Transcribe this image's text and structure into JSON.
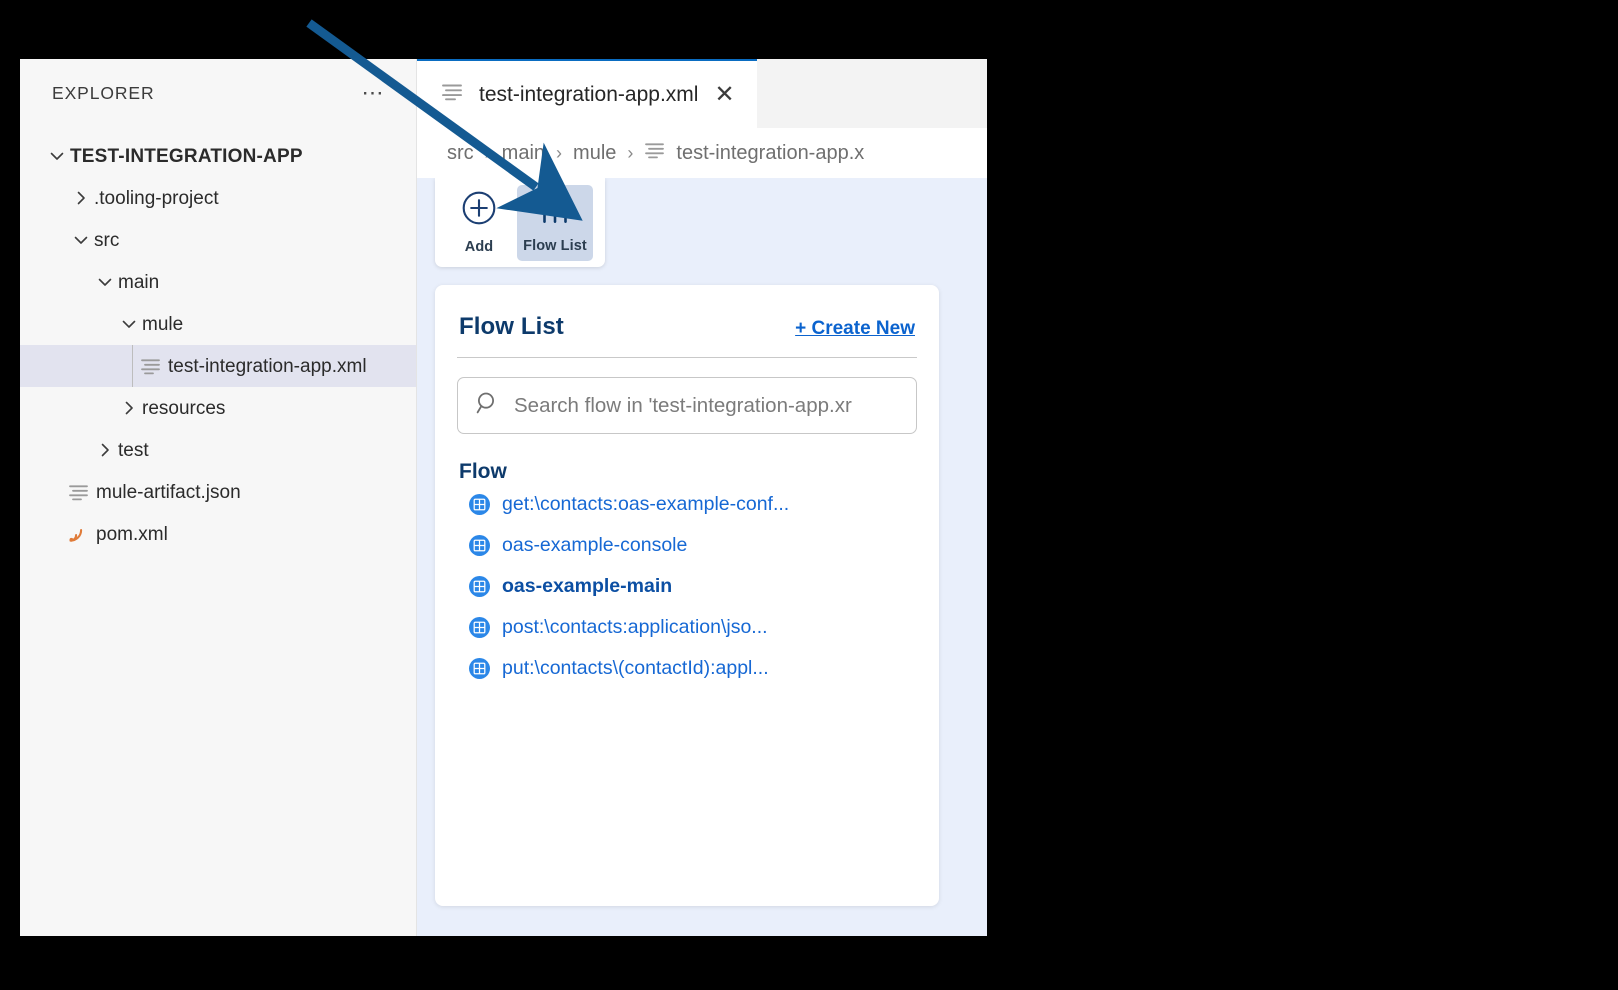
{
  "explorer": {
    "title": "EXPLORER",
    "more_icon": "ellipsis-icon",
    "tree": [
      {
        "label": "TEST-INTEGRATION-APP",
        "depth": 0,
        "type": "folder",
        "expanded": true,
        "bold": true
      },
      {
        "label": ".tooling-project",
        "depth": 1,
        "type": "folder",
        "expanded": false,
        "bold": false
      },
      {
        "label": "src",
        "depth": 1,
        "type": "folder",
        "expanded": true,
        "bold": false
      },
      {
        "label": "main",
        "depth": 2,
        "type": "folder",
        "expanded": true,
        "bold": false
      },
      {
        "label": "mule",
        "depth": 3,
        "type": "folder",
        "expanded": true,
        "bold": false
      },
      {
        "label": "test-integration-app.xml",
        "depth": 4,
        "type": "xml-file",
        "selected": true,
        "bold": false
      },
      {
        "label": "resources",
        "depth": 3,
        "type": "folder",
        "expanded": false,
        "bold": false
      },
      {
        "label": "test",
        "depth": 2,
        "type": "folder",
        "expanded": false,
        "bold": false
      },
      {
        "label": "mule-artifact.json",
        "depth": 1,
        "type": "json-file",
        "bold": false
      },
      {
        "label": "pom.xml",
        "depth": 1,
        "type": "pom-file",
        "bold": false
      }
    ]
  },
  "editor": {
    "tab": {
      "icon": "file-lines-icon",
      "title": "test-integration-app.xml",
      "close_label": "✕"
    },
    "breadcrumb": {
      "separator": "›",
      "items": [
        "src",
        "main",
        "mule"
      ],
      "file": "test-integration-app.x"
    },
    "toolbar": {
      "buttons": [
        {
          "label": "Add",
          "icon": "plus-circle-icon",
          "active": false
        },
        {
          "label": "Flow List",
          "icon": "sliders-icon",
          "active": true
        }
      ]
    },
    "flow_panel": {
      "title": "Flow List",
      "create_new_label": "+ Create New",
      "search": {
        "icon": "search-icon",
        "placeholder": "Search flow in  'test-integration-app.xr"
      },
      "group_label": "Flow",
      "items": [
        {
          "label": "get:\\contacts:oas-example-conf...",
          "icon": "flow-icon",
          "current": false
        },
        {
          "label": "oas-example-console",
          "icon": "flow-icon",
          "current": false
        },
        {
          "label": "oas-example-main",
          "icon": "flow-icon",
          "current": true
        },
        {
          "label": "post:\\contacts:application\\jso...",
          "icon": "flow-icon",
          "current": false
        },
        {
          "label": "put:\\contacts\\(contactId):appl...",
          "icon": "flow-icon",
          "current": false
        }
      ]
    }
  },
  "annotation": {
    "arrow_color": "#145a92",
    "arrow_name": "pointer-arrow"
  },
  "colors": {
    "canvas_bg": "#e9effb",
    "sidebar_bg": "#f7f7f7",
    "tab_accent": "#0a6cc1",
    "link_blue": "#0b63ce",
    "flow_blue": "#1668d4",
    "heading_navy": "#0d3a6b",
    "active_tool_bg": "#ccd7e9"
  }
}
